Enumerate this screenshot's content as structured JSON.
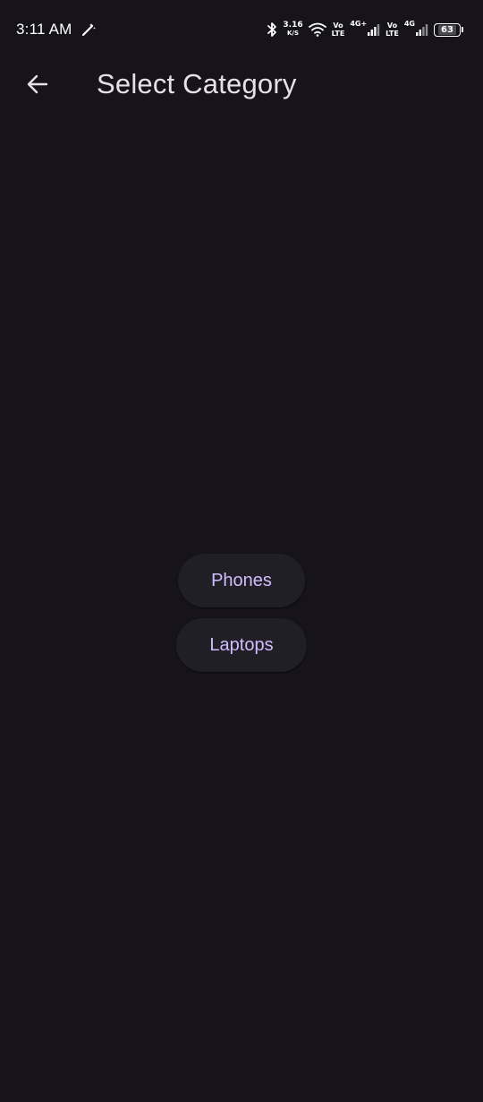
{
  "status_bar": {
    "time": "3:11 AM",
    "network_speed": "3.16",
    "network_speed_unit": "K/S",
    "sim1_label_top": "Vo",
    "sim1_label_bottom": "LTE",
    "sim1_network": "4G+",
    "sim2_label_top": "Vo",
    "sim2_label_bottom": "LTE",
    "sim2_network": "4G",
    "battery": "63",
    "icons": [
      "edit-icon",
      "bluetooth-icon",
      "wifi-icon",
      "signal-icon",
      "battery-icon"
    ]
  },
  "app_bar": {
    "title": "Select Category",
    "back_icon": "arrow-back-icon"
  },
  "categories": [
    {
      "label": "Phones"
    },
    {
      "label": "Laptops"
    }
  ],
  "colors": {
    "background": "#16141a",
    "button_background": "#211f26",
    "button_text": "#cfbdfe",
    "title_text": "#e6e1e9"
  }
}
